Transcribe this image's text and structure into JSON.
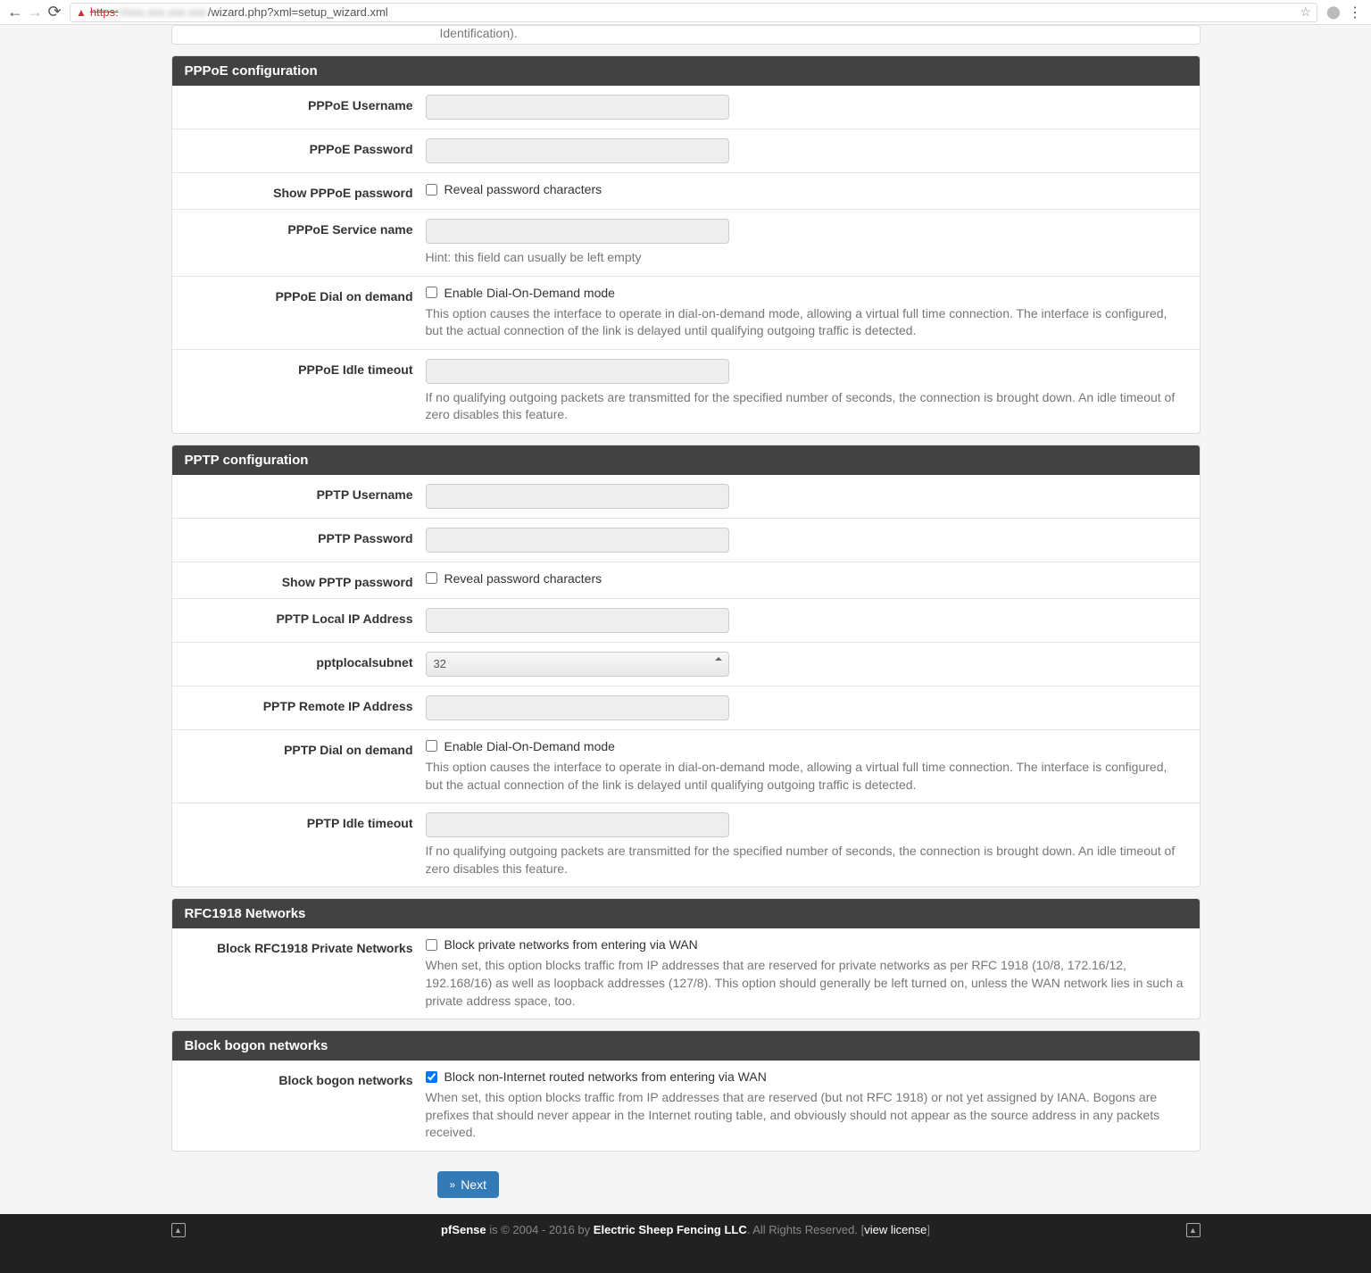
{
  "browser": {
    "url_https": "https:",
    "url_host": "//xxx.xxx.xxx.xxx",
    "url_path": "/wizard.php?xml=setup_wizard.xml"
  },
  "top_text": "Identification).",
  "pppoe": {
    "header": "PPPoE configuration",
    "username_label": "PPPoE Username",
    "password_label": "PPPoE Password",
    "showpass_label": "Show PPPoE password",
    "showpass_check": "Reveal password characters",
    "service_label": "PPPoE Service name",
    "service_hint": "Hint: this field can usually be left empty",
    "dod_label": "PPPoE Dial on demand",
    "dod_check": "Enable Dial-On-Demand mode",
    "dod_help": "This option causes the interface to operate in dial-on-demand mode, allowing a virtual full time connection. The interface is configured, but the actual connection of the link is delayed until qualifying outgoing traffic is detected.",
    "idle_label": "PPPoE Idle timeout",
    "idle_help": "If no qualifying outgoing packets are transmitted for the specified number of seconds, the connection is brought down. An idle timeout of zero disables this feature."
  },
  "pptp": {
    "header": "PPTP configuration",
    "username_label": "PPTP Username",
    "password_label": "PPTP Password",
    "showpass_label": "Show PPTP password",
    "showpass_check": "Reveal password characters",
    "localip_label": "PPTP Local IP Address",
    "subnet_label": "pptplocalsubnet",
    "subnet_value": "32",
    "remoteip_label": "PPTP Remote IP Address",
    "dod_label": "PPTP Dial on demand",
    "dod_check": "Enable Dial-On-Demand mode",
    "dod_help": "This option causes the interface to operate in dial-on-demand mode, allowing a virtual full time connection. The interface is configured, but the actual connection of the link is delayed until qualifying outgoing traffic is detected.",
    "idle_label": "PPTP Idle timeout",
    "idle_help": "If no qualifying outgoing packets are transmitted for the specified number of seconds, the connection is brought down. An idle timeout of zero disables this feature."
  },
  "rfc1918": {
    "header": "RFC1918 Networks",
    "label": "Block RFC1918 Private Networks",
    "check": "Block private networks from entering via WAN",
    "help": "When set, this option blocks traffic from IP addresses that are reserved for private networks as per RFC 1918 (10/8, 172.16/12, 192.168/16) as well as loopback addresses (127/8). This option should generally be left turned on, unless the WAN network lies in such a private address space, too."
  },
  "bogon": {
    "header": "Block bogon networks",
    "label": "Block bogon networks",
    "check": "Block non-Internet routed networks from entering via WAN",
    "help": "When set, this option blocks traffic from IP addresses that are reserved (but not RFC 1918) or not yet assigned by IANA. Bogons are prefixes that should never appear in the Internet routing table, and obviously should not appear as the source address in any packets received."
  },
  "next": "Next",
  "footer": {
    "brand": "pfSense",
    "mid": " is © 2004 - 2016 by ",
    "company": "Electric Sheep Fencing LLC",
    "rights": ". All Rights Reserved. [",
    "link": "view license",
    "close": "]"
  }
}
